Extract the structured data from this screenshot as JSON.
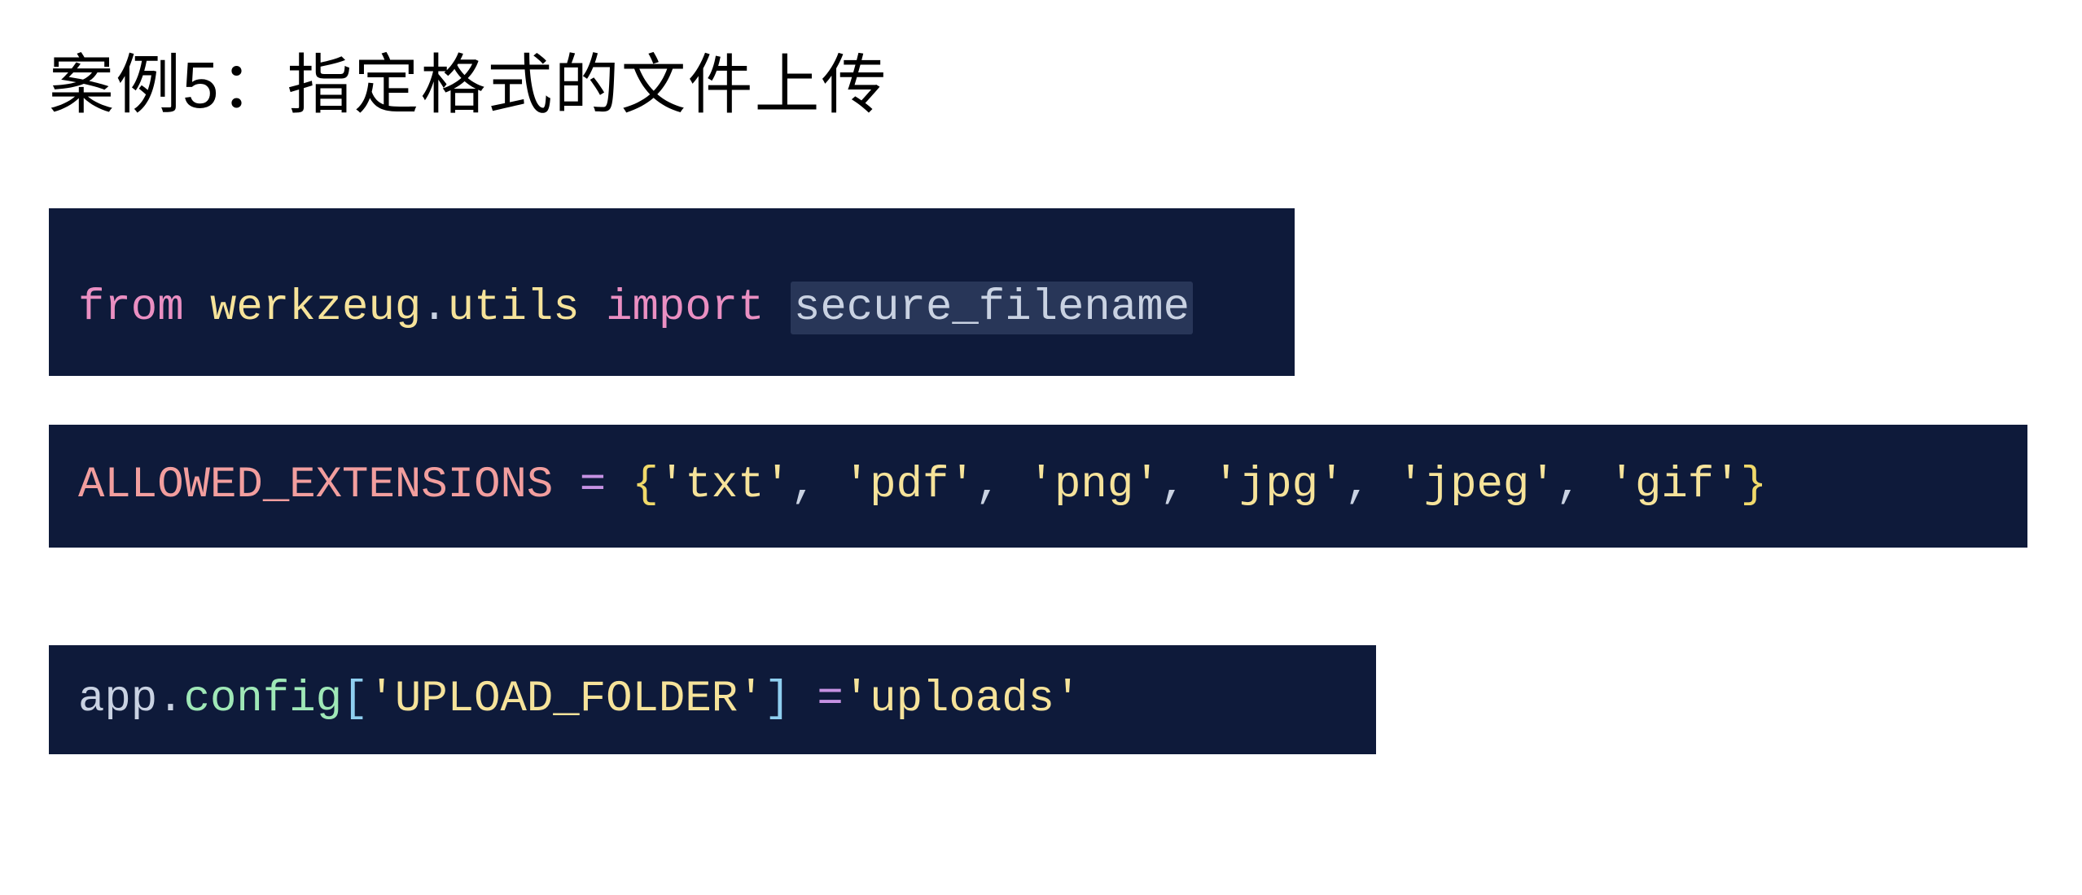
{
  "heading": "案例5：指定格式的文件上传",
  "block1": {
    "from": "from ",
    "module": "werkzeug",
    "dot": ".",
    "submodule": "utils",
    "import": " import ",
    "name": "secure_filename"
  },
  "block2": {
    "const": "ALLOWED_EXTENSIONS",
    "space1": " ",
    "eq": "=",
    "space2": " ",
    "lbrace": "{",
    "s1": "'txt'",
    "c1": ", ",
    "s2": "'pdf'",
    "c2": ", ",
    "s3": "'png'",
    "c3": ", ",
    "s4": "'jpg'",
    "c4": ", ",
    "s5": "'jpeg'",
    "c5": ", ",
    "s6": "'gif'",
    "rbrace": "}"
  },
  "block3": {
    "app": "app",
    "dot": ".",
    "config": "config",
    "lbrack": "[",
    "key": "'UPLOAD_FOLDER'",
    "rbrack": "]",
    "space1": " ",
    "eq": "=",
    "val": "'uploads'"
  }
}
